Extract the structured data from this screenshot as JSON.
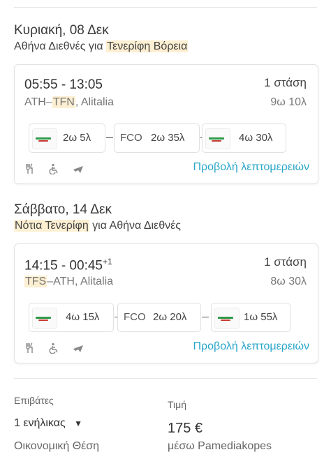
{
  "outbound": {
    "date": "Κυριακή, 08 Δεκ",
    "route_prefix": "Αθήνα Διεθνές για ",
    "route_highlight": "Τενερίφη Βόρεια",
    "times": "05:55 - 13:05",
    "stops": "1 στάση",
    "code_from": "ATH–",
    "code_to": "TFN",
    "airline_suffix": ", Alitalia",
    "duration": "9ω 10λ",
    "segments": [
      {
        "duration": "2ω 5λ"
      },
      {
        "code": "FCO",
        "duration": "2ω 35λ"
      },
      {
        "duration": "4ω 30λ"
      }
    ],
    "details_link": "Προβολή λεπτομερειών"
  },
  "inbound": {
    "date": "Σάββατο, 14 Δεκ",
    "route_highlight": "Νότια Τενερίφη",
    "route_suffix": " για Αθήνα Διεθνές",
    "times": "14:15 - 00:45",
    "day_offset": "+1",
    "stops": "1 στάση",
    "code_from": "TFS",
    "code_to": "–ATH",
    "airline_suffix": ", Alitalia",
    "duration": "8ω 30λ",
    "segments": [
      {
        "duration": "4ω 15λ"
      },
      {
        "code": "FCO",
        "duration": "2ω 20λ"
      },
      {
        "duration": "1ω 55λ"
      }
    ],
    "details_link": "Προβολή λεπτομερειών"
  },
  "summary": {
    "passengers_label": "Επιβάτες",
    "passengers_value": "1 ενήλικας",
    "dropdown_icon": "▼",
    "cabin_class": "Οικονομική Θέση",
    "price_label": "Τιμή",
    "price_value": "175 €",
    "via": "μέσω Pamediakopes"
  },
  "colors": {
    "link": "#2aa6c8",
    "highlight": "#fdefd2",
    "airline_logo_green": "#2f9a4a"
  },
  "icons": [
    "meal-icon",
    "accessibility-icon",
    "flight-icon"
  ]
}
